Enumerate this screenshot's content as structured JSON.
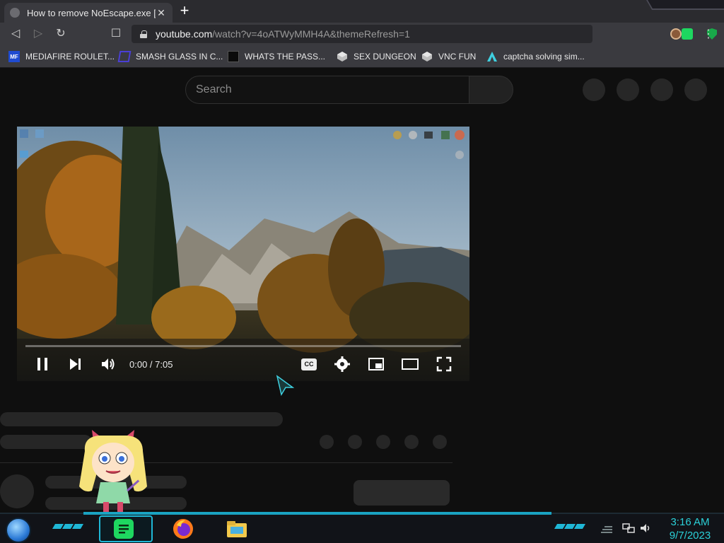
{
  "browser": {
    "tab": {
      "title": "How to remove NoEscape.exe [Do",
      "close_glyph": "✕"
    },
    "new_tab_glyph": "+",
    "nav": {
      "back_glyph": "◁",
      "forward_glyph": "▷",
      "reload_glyph": "↻",
      "bookmark_glyph": "☐"
    },
    "url": {
      "host": "youtube.com",
      "path": "/watch?v=4oATWyMMH4A&themeRefresh=1"
    },
    "menu_glyph": "⋮",
    "bookmarks": [
      {
        "label": "MEDIAFIRE ROULET...",
        "icon": "mediafire-icon",
        "icon_text": "MF",
        "color": "#1f4bd1"
      },
      {
        "label": "SMASH GLASS IN C...",
        "icon": "smash-glass-icon",
        "icon_text": "",
        "color": "#4a3fd6"
      },
      {
        "label": "WHATS THE PASS...",
        "icon": "password-site-icon",
        "icon_text": "",
        "color": "#0b0b0b"
      },
      {
        "label": "SEX DUNGEON",
        "icon": "dungeon-cube-icon",
        "icon_text": "",
        "color": "#9a9a9a"
      },
      {
        "label": "VNC FUN",
        "icon": "vnc-cube-icon",
        "icon_text": "",
        "color": "#9a9a9a"
      },
      {
        "label": "captcha solving sim...",
        "icon": "captcha-a-icon",
        "icon_text": "",
        "color": "#3fd0e0"
      }
    ]
  },
  "youtube": {
    "search_placeholder": "Search",
    "player": {
      "time": "0:00 / 7:05",
      "cc_label": "CC",
      "progress": 0
    }
  },
  "taskbar": {
    "clock_time": "3:16 AM",
    "clock_date": "9/7/2023"
  },
  "colors": {
    "accent_cyan": "#1aa3c2",
    "clock_cyan": "#2bd0d8",
    "page_bg": "#0f0f0f"
  }
}
